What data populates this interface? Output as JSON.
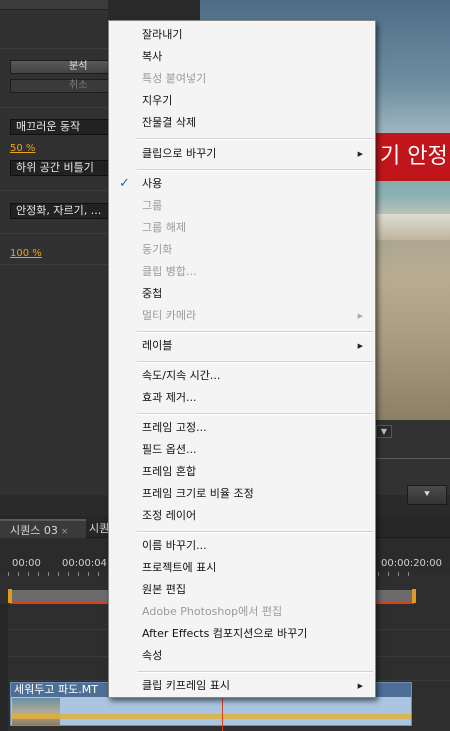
{
  "left_panel": {
    "analyze_button": "분석",
    "cancel_button": "취소",
    "mode_dropdown": "매끄러운 동작",
    "smoothness_value": "50 %",
    "method_dropdown": "하위 공간 비틀기",
    "framing_dropdown": "안정화, 자르기, ...",
    "scale_value": "100 %"
  },
  "monitor": {
    "caption_text": "기 안정"
  },
  "timeline": {
    "tabs": [
      {
        "label": "시퀀스 03",
        "close": "×"
      },
      {
        "label": "시퀀"
      }
    ],
    "timecodes": [
      "00:00",
      "00:00:04:",
      "00:00:20:00"
    ],
    "clip_name": "세워두고 파도.MT"
  },
  "context_menu": {
    "items": [
      {
        "label": "잘라내기",
        "enabled": true
      },
      {
        "label": "복사",
        "enabled": true
      },
      {
        "label": "특성 붙여넣기",
        "enabled": false
      },
      {
        "label": "지우기",
        "enabled": true
      },
      {
        "label": "잔물결 삭제",
        "enabled": true
      },
      {
        "label": "클립으로 바꾸기",
        "enabled": true,
        "submenu": true
      },
      {
        "label": "사용",
        "enabled": true,
        "checked": true
      },
      {
        "label": "그룹",
        "enabled": false
      },
      {
        "label": "그룹 해제",
        "enabled": false
      },
      {
        "label": "동기화",
        "enabled": false
      },
      {
        "label": "클립 병합...",
        "enabled": false
      },
      {
        "label": "중첩",
        "enabled": true
      },
      {
        "label": "멀티 카메라",
        "enabled": false,
        "submenu": true
      },
      {
        "label": "레이블",
        "enabled": true,
        "submenu": true
      },
      {
        "label": "속도/지속 시간...",
        "enabled": true
      },
      {
        "label": "효과 제거...",
        "enabled": true
      },
      {
        "label": "프레임 고정...",
        "enabled": true
      },
      {
        "label": "필드 옵션...",
        "enabled": true
      },
      {
        "label": "프레임 혼합",
        "enabled": true
      },
      {
        "label": "프레임 크기로 비율 조정",
        "enabled": true
      },
      {
        "label": "조정 레이어",
        "enabled": true
      },
      {
        "label": "이름 바꾸기...",
        "enabled": true
      },
      {
        "label": "프로젝트에 표시",
        "enabled": true
      },
      {
        "label": "원본 편집",
        "enabled": true
      },
      {
        "label": "Adobe Photoshop에서 편집",
        "enabled": false
      },
      {
        "label": "After Effects 컴포지션으로 바꾸기",
        "enabled": true
      },
      {
        "label": "속성",
        "enabled": true
      },
      {
        "label": "클립 키프레임 표시",
        "enabled": true,
        "submenu": true
      }
    ],
    "check_glyph": "✓",
    "submenu_glyph": "▶"
  },
  "colors": {
    "accent_value": "#e8a51c",
    "caption_bg": "#c0161b",
    "clip_fill": "#a9c5e0",
    "check": "#2a62c9"
  }
}
